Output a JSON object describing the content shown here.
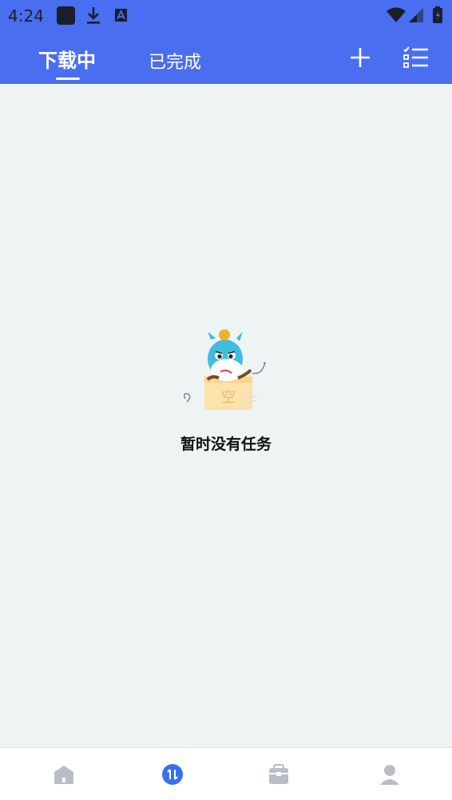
{
  "status_bar": {
    "time": "4:24",
    "icons": [
      "notification-square-icon",
      "download-icon",
      "font-a-icon"
    ],
    "right_icons": [
      "wifi-icon",
      "signal-icon",
      "battery-icon"
    ]
  },
  "header": {
    "tabs": [
      {
        "label": "下载中",
        "active": true
      },
      {
        "label": "已完成",
        "active": false
      }
    ],
    "actions": [
      "add-icon",
      "task-list-icon"
    ]
  },
  "empty_state": {
    "illustration": "empty-box-mascot-icon",
    "box_label": "空",
    "message": "暂时没有任务"
  },
  "bottom_nav": {
    "items": [
      {
        "icon": "home-icon",
        "active": false
      },
      {
        "icon": "transfer-icon",
        "active": true
      },
      {
        "icon": "toolbox-icon",
        "active": false
      },
      {
        "icon": "profile-icon",
        "active": false
      }
    ],
    "active_color": "#3a6ff0",
    "inactive_color": "#b8bec3"
  },
  "colors": {
    "header_bg": "#4a6ef0",
    "content_bg": "#eef3f4"
  }
}
